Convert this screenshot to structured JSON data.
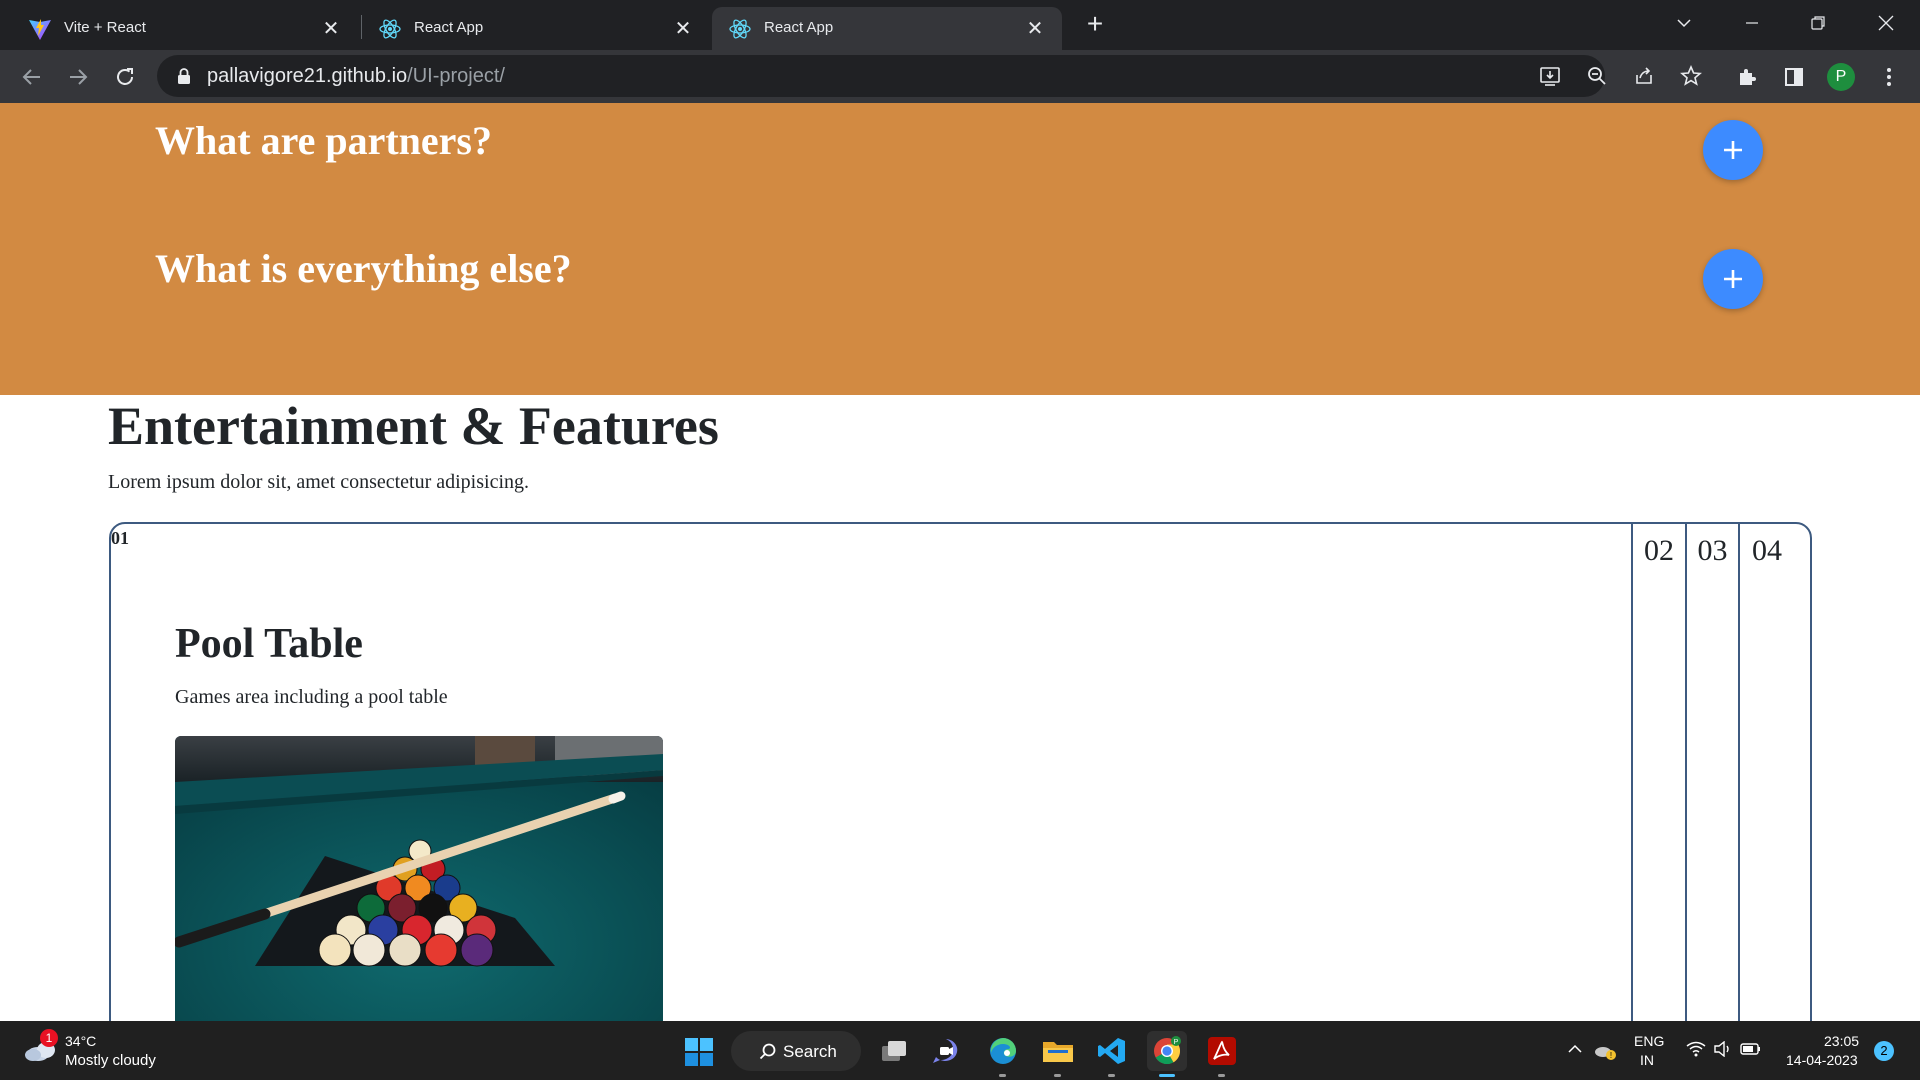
{
  "browser": {
    "tabs": [
      {
        "title": "Vite + React",
        "favicon": "vite-icon",
        "active": false
      },
      {
        "title": "React App",
        "favicon": "react-icon",
        "active": false
      },
      {
        "title": "React App",
        "favicon": "react-icon",
        "active": true
      }
    ],
    "url_host": "pallavigore21.github.io",
    "url_path": "/UI-project/",
    "profile_initial": "P"
  },
  "page": {
    "faq": [
      {
        "question": "What are partners?"
      },
      {
        "question": "What is everything else?"
      }
    ],
    "features_title": "Entertainment & Features",
    "features_subtitle": "Lorem ipsum dolor sit, amet consectetur adipisicing.",
    "tabs": [
      "01",
      "02",
      "03",
      "04"
    ],
    "active_panel": {
      "title": "Pool Table",
      "description": "Games area including a pool table"
    },
    "colors": {
      "faq_bg": "#d28a42",
      "faq_button": "#3d8bff",
      "card_border": "#3d5a80"
    }
  },
  "taskbar": {
    "weather_temp": "34°C",
    "weather_desc": "Mostly cloudy",
    "weather_badge": "1",
    "search_label": "Search",
    "lang_line1": "ENG",
    "lang_line2": "IN",
    "time": "23:05",
    "date": "14-04-2023",
    "notification_count": "2"
  }
}
